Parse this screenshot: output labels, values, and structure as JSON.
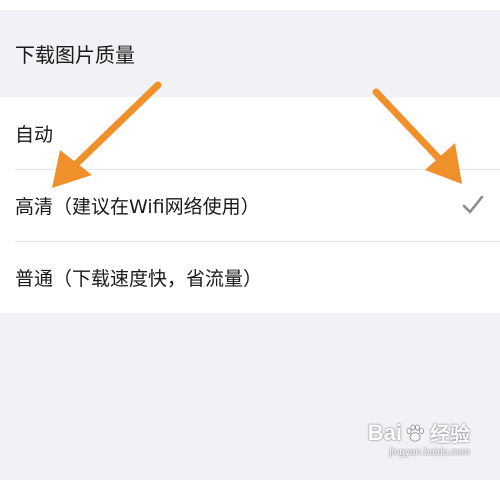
{
  "section": {
    "title": "下载图片质量"
  },
  "options": [
    {
      "label": "自动",
      "selected": false
    },
    {
      "label": "高清（建议在Wifi网络使用）",
      "selected": true
    },
    {
      "label": "普通（下载速度快，省流量）",
      "selected": false
    }
  ],
  "checkmark_icon": "checkmark-icon",
  "annotation_color": "#f0902a",
  "watermark": {
    "brand": "Bai",
    "product": "经验",
    "url": "jingyan.baidu.com"
  }
}
